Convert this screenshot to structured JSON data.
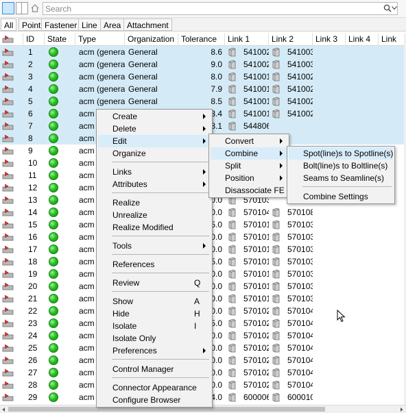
{
  "toolbar": {
    "search_placeholder": "Search",
    "icons": [
      "single-view-icon",
      "split-view-icon",
      "home-icon",
      "search-icon",
      "chevron-down-icon"
    ]
  },
  "tabs": [
    "All",
    "Point",
    "Fastener",
    "Line",
    "Area",
    "Attachment"
  ],
  "columns": [
    "",
    "ID",
    "State",
    "Type",
    "Organization",
    "Tolerance",
    "Link 1",
    "Link 2",
    "Link 3",
    "Link 4",
    "Link"
  ],
  "rows": [
    {
      "id": "1",
      "type": "acm (general)",
      "org": "General",
      "tol": "8.6",
      "link1": "541002",
      "link2": "541003",
      "sel": true
    },
    {
      "id": "2",
      "type": "acm (general)",
      "org": "General",
      "tol": "9.0",
      "link1": "541002",
      "link2": "541003",
      "sel": true
    },
    {
      "id": "3",
      "type": "acm (general)",
      "org": "General",
      "tol": "8.0",
      "link1": "541001",
      "link2": "541002",
      "sel": true
    },
    {
      "id": "4",
      "type": "acm (general)",
      "org": "General",
      "tol": "7.9",
      "link1": "541001",
      "link2": "541002",
      "sel": true
    },
    {
      "id": "5",
      "type": "acm (general)",
      "org": "General",
      "tol": "8.5",
      "link1": "541001",
      "link2": "541002",
      "sel": true
    },
    {
      "id": "6",
      "type": "acm",
      "org": "",
      "tol": "8.4",
      "link1": "541001",
      "link2": "541002",
      "sel": true
    },
    {
      "id": "7",
      "type": "acm",
      "org": "",
      "tol": "8.1",
      "link1": "544806",
      "link2": "",
      "sel": true
    },
    {
      "id": "8",
      "type": "acm",
      "org": "",
      "tol": "",
      "link1": "",
      "link2": "",
      "sel": true
    },
    {
      "id": "9",
      "type": "acm",
      "org": "",
      "tol": "",
      "link1": "",
      "link2": "",
      "sel": false
    },
    {
      "id": "10",
      "type": "acm",
      "org": "",
      "tol": "",
      "link1": "",
      "link2": "",
      "sel": false
    },
    {
      "id": "11",
      "type": "acm",
      "org": "",
      "tol": "",
      "link1": "",
      "link2": "",
      "sel": false
    },
    {
      "id": "12",
      "type": "acm",
      "org": "",
      "tol": "",
      "link1": "",
      "link2": "",
      "sel": false
    },
    {
      "id": "13",
      "type": "acm",
      "org": "",
      "tol": "0.0",
      "link1": "570103",
      "link2": "",
      "sel": false
    },
    {
      "id": "14",
      "type": "acm",
      "org": "",
      "tol": "0.0",
      "link1": "570104",
      "link2": "570108",
      "sel": false
    },
    {
      "id": "15",
      "type": "acm",
      "org": "",
      "tol": "5.0",
      "link1": "570101",
      "link2": "570103",
      "sel": false
    },
    {
      "id": "16",
      "type": "acm",
      "org": "",
      "tol": "0.0",
      "link1": "570101",
      "link2": "570103",
      "sel": false
    },
    {
      "id": "17",
      "type": "acm",
      "org": "",
      "tol": "0.0",
      "link1": "570101",
      "link2": "570103",
      "sel": false
    },
    {
      "id": "18",
      "type": "acm",
      "org": "",
      "tol": "5.0",
      "link1": "570101",
      "link2": "570103",
      "sel": false
    },
    {
      "id": "19",
      "type": "acm",
      "org": "",
      "tol": "0.0",
      "link1": "570101",
      "link2": "570103",
      "sel": false
    },
    {
      "id": "20",
      "type": "acm",
      "org": "",
      "tol": "0.0",
      "link1": "570101",
      "link2": "570103",
      "sel": false
    },
    {
      "id": "21",
      "type": "acm",
      "org": "",
      "tol": "0.0",
      "link1": "570101",
      "link2": "570103",
      "sel": false
    },
    {
      "id": "22",
      "type": "acm",
      "org": "",
      "tol": "0.0",
      "link1": "570102",
      "link2": "570104",
      "sel": false
    },
    {
      "id": "23",
      "type": "acm",
      "org": "",
      "tol": "5.0",
      "link1": "570102",
      "link2": "570104",
      "sel": false
    },
    {
      "id": "24",
      "type": "acm",
      "org": "",
      "tol": "0.0",
      "link1": "570102",
      "link2": "570104",
      "sel": false
    },
    {
      "id": "25",
      "type": "acm",
      "org": "",
      "tol": "0.0",
      "link1": "570102",
      "link2": "570104",
      "sel": false
    },
    {
      "id": "26",
      "type": "acm",
      "org": "",
      "tol": "0.0",
      "link1": "570102",
      "link2": "570104",
      "sel": false
    },
    {
      "id": "27",
      "type": "acm",
      "org": "",
      "tol": "0.0",
      "link1": "570102",
      "link2": "570104",
      "sel": false
    },
    {
      "id": "28",
      "type": "acm",
      "org": "",
      "tol": "0.0",
      "link1": "570102",
      "link2": "570104",
      "sel": false
    },
    {
      "id": "29",
      "type": "acm",
      "org": "",
      "tol": "4.0",
      "link1": "600006",
      "link2": "600010",
      "sel": false
    }
  ],
  "context_menu": {
    "items": [
      {
        "label": "Create",
        "submenu": true
      },
      {
        "label": "Delete",
        "submenu": true
      },
      {
        "label": "Edit",
        "submenu": true,
        "active": true
      },
      {
        "label": "Organize"
      },
      {
        "sep": true
      },
      {
        "label": "Links",
        "submenu": true
      },
      {
        "label": "Attributes",
        "submenu": true
      },
      {
        "sep": true
      },
      {
        "label": "Realize"
      },
      {
        "label": "Unrealize"
      },
      {
        "label": "Realize Modified"
      },
      {
        "sep": true
      },
      {
        "label": "Tools",
        "submenu": true
      },
      {
        "sep": true
      },
      {
        "label": "References"
      },
      {
        "sep": true
      },
      {
        "label": "Review",
        "shortcut": "Q"
      },
      {
        "sep": true
      },
      {
        "label": "Show",
        "shortcut": "A"
      },
      {
        "label": "Hide",
        "shortcut": "H"
      },
      {
        "label": "Isolate",
        "shortcut": "I"
      },
      {
        "label": "Isolate Only"
      },
      {
        "label": "Preferences",
        "submenu": true
      },
      {
        "sep": true
      },
      {
        "label": "Control Manager"
      },
      {
        "sep": true
      },
      {
        "label": "Connector Appearance"
      },
      {
        "label": "Configure Browser"
      }
    ]
  },
  "edit_submenu": {
    "items": [
      {
        "label": "Convert",
        "submenu": true
      },
      {
        "label": "Combine",
        "submenu": true,
        "active": true
      },
      {
        "label": "Split",
        "submenu": true
      },
      {
        "label": "Position",
        "submenu": true
      },
      {
        "label": "Disassociate FE"
      }
    ]
  },
  "combine_submenu": {
    "items": [
      {
        "label": "Spot(line)s to Spotline(s)",
        "active": true
      },
      {
        "label": "Bolt(line)s to Boltline(s)"
      },
      {
        "label": "Seams to Seamline(s)"
      },
      {
        "sep": true
      },
      {
        "label": "Combine Settings"
      }
    ]
  },
  "colors": {
    "selection": "#d4ebf7",
    "menu_bg": "#f2f2f2",
    "menu_highlight": "#d8ecf9",
    "status_green": "#27c320"
  }
}
